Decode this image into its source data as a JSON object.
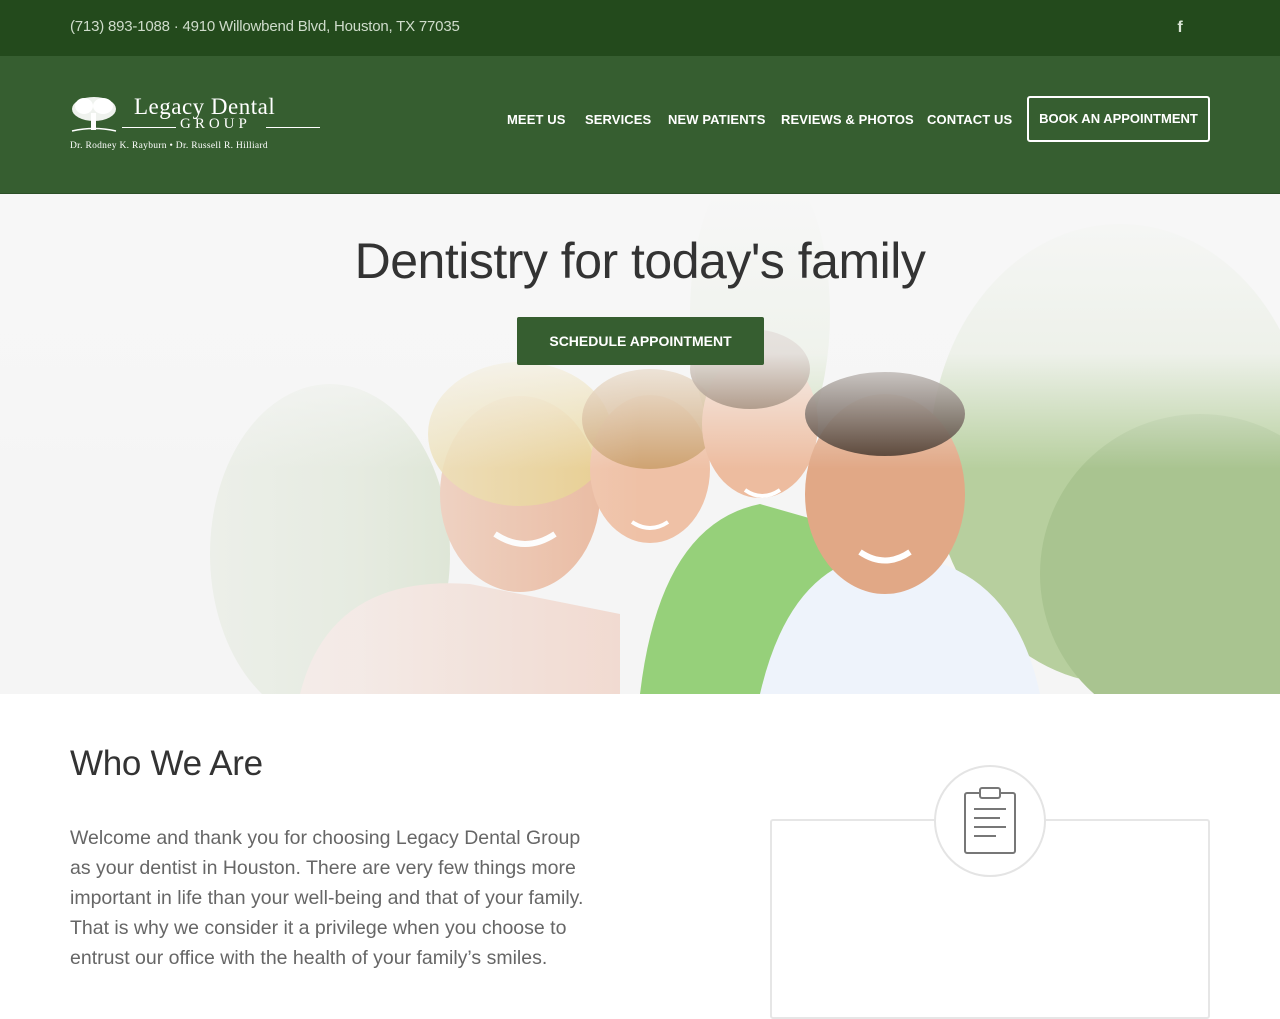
{
  "topbar": {
    "contact": "(713) 893-1088 · 4910 Willowbend Blvd, Houston, TX 77035",
    "social_icon": "facebook-icon",
    "social_glyph": "f"
  },
  "logo": {
    "line1": "Legacy Dental",
    "line2": "GROUP",
    "line3": "Dr. Rodney K. Rayburn  •  Dr. Russell R. Hilliard",
    "icon": "tree-icon"
  },
  "nav": {
    "items": [
      {
        "label": "MEET US"
      },
      {
        "label": "SERVICES"
      },
      {
        "label": "NEW PATIENTS"
      },
      {
        "label": "REVIEWS & PHOTOS"
      },
      {
        "label": "CONTACT US"
      }
    ],
    "cta": "BOOK AN APPOINTMENT"
  },
  "hero": {
    "title": "Dentistry for today's family",
    "cta": "SCHEDULE APPOINTMENT"
  },
  "about": {
    "title": "Who We Are",
    "body": "Welcome and thank you for choosing Legacy Dental Group as your dentist in Houston. There are very few things more important in life than your well-being and that of your family. That is why we consider it a privilege when you choose to entrust our office with the health of your family’s smiles."
  },
  "card": {
    "icon": "clipboard-icon"
  },
  "colors": {
    "topbar": "#234a1c",
    "header": "#365e30",
    "accent": "#365e30"
  }
}
